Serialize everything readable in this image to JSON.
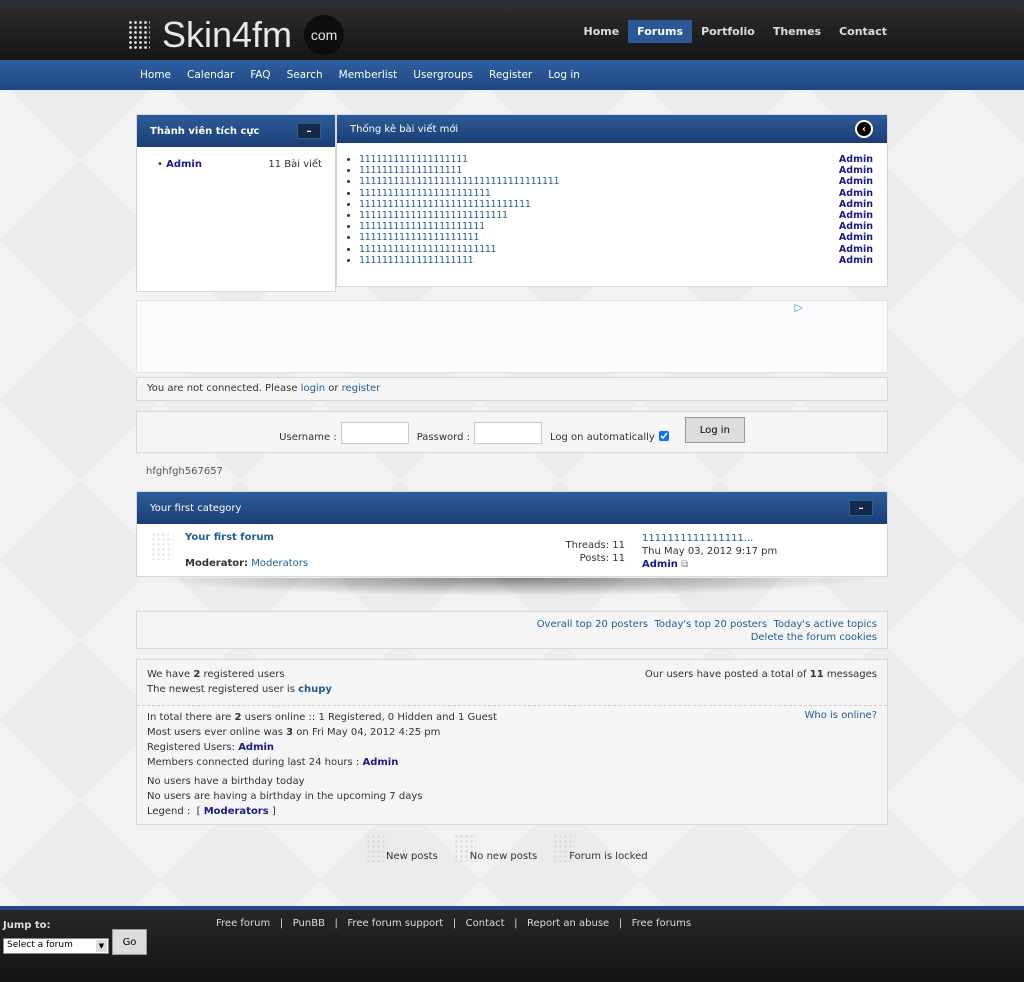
{
  "brand": {
    "name": "Skin4fm",
    "suffix": "com"
  },
  "top_nav": [
    "Home",
    "Forums",
    "Portfolio",
    "Themes",
    "Contact"
  ],
  "top_nav_active": "Forums",
  "nav": [
    "Home",
    "Calendar",
    "FAQ",
    "Search",
    "Memberlist",
    "Usergroups",
    "Register",
    "Log in"
  ],
  "active_members": {
    "title": "Thành viên tích cực",
    "items": [
      {
        "name": "Admin",
        "count": "11 Bài viết"
      }
    ]
  },
  "recent_posts": {
    "title": "Thống kê bài viết mới",
    "items": [
      {
        "title": "1111111111111111111",
        "author": "Admin"
      },
      {
        "title": "111111111111111111",
        "author": "Admin"
      },
      {
        "title": "11111111111111111111111111111111111",
        "author": "Admin"
      },
      {
        "title": "11111111111111111111111",
        "author": "Admin"
      },
      {
        "title": "111111111111111111111111111111",
        "author": "Admin"
      },
      {
        "title": "11111111111111111111111111",
        "author": "Admin"
      },
      {
        "title": "1111111111111111111111",
        "author": "Admin"
      },
      {
        "title": "111111111111111111111",
        "author": "Admin"
      },
      {
        "title": "111111111111111111111111",
        "author": "Admin"
      },
      {
        "title": "11111111111111111111",
        "author": "Admin"
      }
    ]
  },
  "notice": {
    "text": "You are not connected. Please ",
    "login": "login",
    "or": " or ",
    "register": "register"
  },
  "login_form": {
    "username_label": "Username :",
    "password_label": "Password :",
    "auto_label": "Log on automatically",
    "auto_checked": true,
    "button": "Log in"
  },
  "custom_text": "hfghfgh567657",
  "category": {
    "title": "Your first category",
    "forum": {
      "name": "Your first forum",
      "moderator_label": "Moderator:",
      "moderator": "Moderators",
      "threads": "Threads: 11",
      "posts": "Posts: 11",
      "last_title": "1111111111111111...",
      "last_date": "Thu May 03, 2012 9:17 pm",
      "last_author": "Admin"
    }
  },
  "links": [
    "Overall top 20 posters",
    "Today's top 20 posters",
    "Today's active topics",
    "Delete the forum cookies"
  ],
  "stats": {
    "registered_pre": "We have ",
    "registered_count": "2",
    "registered_post": " registered users",
    "newest_pre": "The newest registered user is ",
    "newest": "chupy",
    "total_pre": "Our users have posted a total of ",
    "total_count": "11",
    "total_post": " messages"
  },
  "online": {
    "who": "Who is online?",
    "l1_pre": "In total there are ",
    "l1_count": "2",
    "l1_post": " users online :: 1 Registered, 0 Hidden and 1 Guest",
    "l2_pre": "Most users ever online was ",
    "l2_count": "3",
    "l2_post": " on Fri May 04, 2012 4:25 pm",
    "l3": "Registered Users: ",
    "l3_user": "Admin",
    "l4": "Members connected during last 24 hours : ",
    "l4_user": "Admin",
    "b1": "No users have a birthday today",
    "b2": "No users are having a birthday in the upcoming 7 days",
    "legend": "Legend :  [ ",
    "legend_item": "Moderators",
    "legend_end": " ]"
  },
  "legend_icons": [
    "New posts",
    "No new posts",
    "Forum is locked"
  ],
  "footer": {
    "jump_label": "Jump to:",
    "select": "Select a forum",
    "go": "Go",
    "links": [
      "Free forum",
      "PunBB",
      "Free forum support",
      "Contact",
      "Report an abuse",
      "Free forums"
    ]
  }
}
